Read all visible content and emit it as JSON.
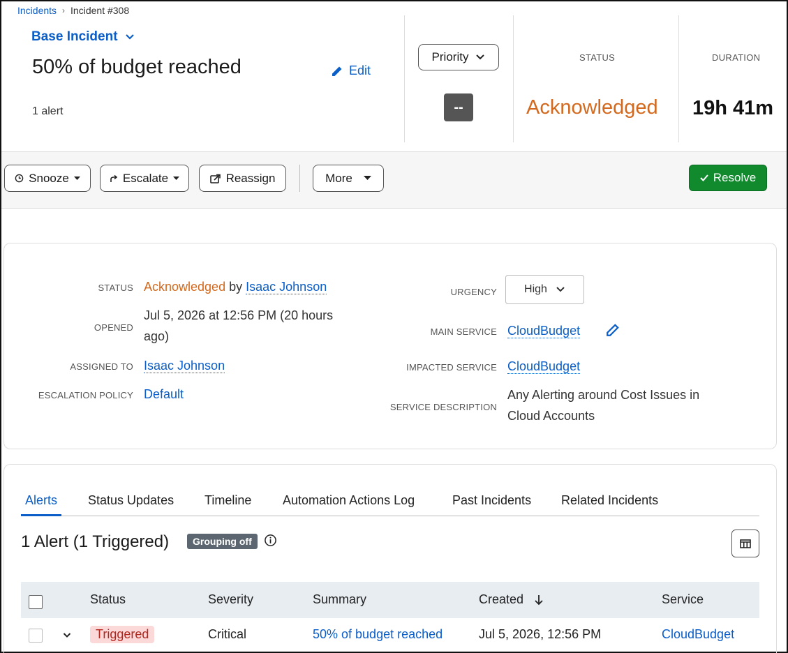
{
  "breadcrumb": {
    "root": "Incidents",
    "separator": "›",
    "current": "Incident #308"
  },
  "incident": {
    "type_selector": "Base Incident",
    "title": "50% of budget reached",
    "edit_label": "Edit",
    "alert_count": "1 alert"
  },
  "header": {
    "priority_label": "Priority",
    "priority_value": "--",
    "status_label": "STATUS",
    "status_value": "Acknowledged",
    "duration_label": "DURATION",
    "duration_value": "19h 41m"
  },
  "toolbar": {
    "snooze": "Snooze",
    "escalate": "Escalate",
    "reassign": "Reassign",
    "more": "More",
    "resolve": "Resolve"
  },
  "details": {
    "status_label": "STATUS",
    "status_value": "Acknowledged",
    "status_by": "by",
    "status_user": "Isaac Johnson",
    "opened_label": "OPENED",
    "opened_value": "Jul 5, 2026 at 12:56 PM (20 hours ago)",
    "assigned_label": "ASSIGNED TO",
    "assigned_value": "Isaac Johnson",
    "escalation_label": "ESCALATION POLICY",
    "escalation_value": "Default",
    "urgency_label": "URGENCY",
    "urgency_value": "High",
    "main_service_label": "MAIN SERVICE",
    "main_service_value": "CloudBudget",
    "impacted_service_label": "IMPACTED SERVICE",
    "impacted_service_value": "CloudBudget",
    "service_desc_label": "SERVICE DESCRIPTION",
    "service_desc_value": "Any Alerting around Cost Issues in Cloud Accounts"
  },
  "tabs": [
    "Alerts",
    "Status Updates",
    "Timeline",
    "Automation Actions Log",
    "Past Incidents",
    "Related Incidents"
  ],
  "alerts": {
    "title": "1 Alert (1 Triggered)",
    "grouping_badge": "Grouping off",
    "columns": [
      "Status",
      "Severity",
      "Summary",
      "Created",
      "Service"
    ],
    "rows": [
      {
        "status": "Triggered",
        "severity": "Critical",
        "summary": "50% of budget reached",
        "created": "Jul 5, 2026, 12:56 PM",
        "service": "CloudBudget"
      }
    ]
  },
  "colors": {
    "link": "#0b5ec7",
    "acknowledged": "#d2691e",
    "resolve": "#118a2e",
    "triggered_bg": "#fbd9d9",
    "triggered_fg": "#b3261e"
  }
}
